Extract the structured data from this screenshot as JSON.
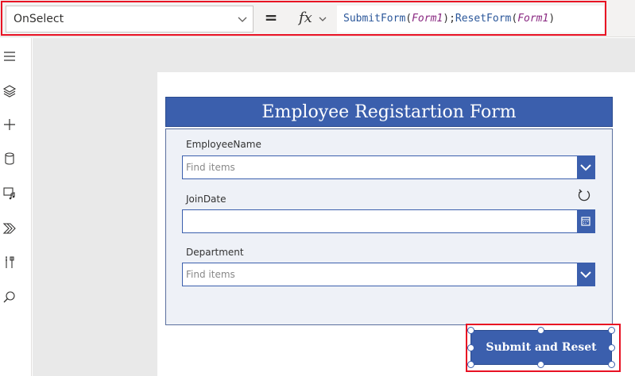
{
  "formula_bar": {
    "property": "OnSelect",
    "equals": "=",
    "fx_label": "fx",
    "formula": {
      "fn1": "SubmitForm",
      "arg1": "Form1",
      "sep": ");",
      "fn2": "ResetForm",
      "arg2": "Form1",
      "close": ")",
      "open": "("
    }
  },
  "left_rail": {
    "icons": [
      "hamburger-icon",
      "layers-icon",
      "plus-icon",
      "database-icon",
      "media-icon",
      "power-automate-icon",
      "tools-icon",
      "search-icon"
    ]
  },
  "form": {
    "title": "Employee Registartion Form",
    "fields": [
      {
        "label": "EmployeeName",
        "placeholder": "Find items"
      },
      {
        "label": "JoinDate",
        "placeholder": ""
      },
      {
        "label": "Department",
        "placeholder": "Find items"
      }
    ]
  },
  "submit_button": {
    "label": "Submit and Reset"
  },
  "colors": {
    "accent": "#3b5fad",
    "highlight": "#e81123"
  }
}
